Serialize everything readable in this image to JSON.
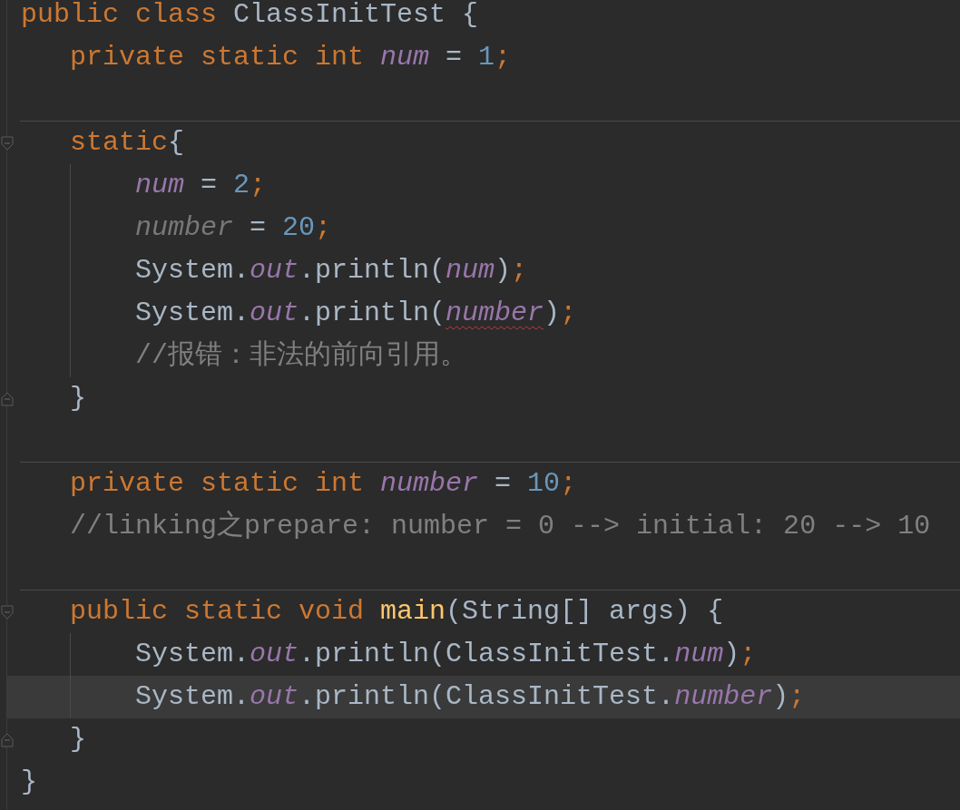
{
  "editor": {
    "lines": [
      {
        "kind": "code",
        "current": false,
        "foldable": false,
        "tokens": [
          {
            "text": "public class ",
            "kind": "keyword"
          },
          {
            "text": "ClassInitTest {",
            "kind": "plain"
          }
        ],
        "children": [
          {
            "kind": "code",
            "current": false,
            "tokens": [
              {
                "text": "private static int ",
                "kind": "keyword"
              },
              {
                "text": "num",
                "kind": "field"
              },
              {
                "text": " = ",
                "kind": "plain"
              },
              {
                "text": "1",
                "kind": "number"
              },
              {
                "text": ";",
                "kind": "keyword"
              }
            ]
          },
          {
            "kind": "separator"
          },
          {
            "kind": "code",
            "current": false,
            "foldable": true,
            "tokens": [
              {
                "text": "static",
                "kind": "keyword"
              },
              {
                "text": "{",
                "kind": "plain"
              }
            ],
            "children": [
              {
                "kind": "code",
                "current": false,
                "tokens": [
                  {
                    "text": "num",
                    "kind": "field"
                  },
                  {
                    "text": " = ",
                    "kind": "plain"
                  },
                  {
                    "text": "2",
                    "kind": "number"
                  },
                  {
                    "text": ";",
                    "kind": "keyword"
                  }
                ]
              },
              {
                "kind": "code",
                "current": false,
                "tokens": [
                  {
                    "text": "number",
                    "kind": "unused"
                  },
                  {
                    "text": " = ",
                    "kind": "plain"
                  },
                  {
                    "text": "20",
                    "kind": "number"
                  },
                  {
                    "text": ";",
                    "kind": "keyword"
                  }
                ]
              },
              {
                "kind": "code",
                "current": false,
                "tokens": [
                  {
                    "text": "System.",
                    "kind": "plain"
                  },
                  {
                    "text": "out",
                    "kind": "field"
                  },
                  {
                    "text": ".println(",
                    "kind": "plain"
                  },
                  {
                    "text": "num",
                    "kind": "field"
                  },
                  {
                    "text": ")",
                    "kind": "plain"
                  },
                  {
                    "text": ";",
                    "kind": "keyword"
                  }
                ]
              },
              {
                "kind": "code",
                "current": false,
                "tokens": [
                  {
                    "text": "System.",
                    "kind": "plain"
                  },
                  {
                    "text": "out",
                    "kind": "field"
                  },
                  {
                    "text": ".println(",
                    "kind": "plain"
                  },
                  {
                    "text": "number",
                    "kind": "error"
                  },
                  {
                    "text": ")",
                    "kind": "plain"
                  },
                  {
                    "text": ";",
                    "kind": "keyword"
                  }
                ]
              },
              {
                "kind": "code",
                "current": false,
                "tokens": [
                  {
                    "text": "//报错：非法的前向引用。",
                    "kind": "comment"
                  }
                ]
              }
            ],
            "closing": {
              "kind": "code",
              "current": false,
              "tokens": [
                {
                  "text": "}",
                  "kind": "plain"
                }
              ]
            }
          },
          {
            "kind": "separator"
          },
          {
            "kind": "code",
            "current": false,
            "tokens": [
              {
                "text": "private static int ",
                "kind": "keyword"
              },
              {
                "text": "number",
                "kind": "field"
              },
              {
                "text": " = ",
                "kind": "plain"
              },
              {
                "text": "10",
                "kind": "number"
              },
              {
                "text": ";",
                "kind": "keyword"
              }
            ]
          },
          {
            "kind": "code",
            "current": false,
            "tokens": [
              {
                "text": "//linking之prepare: number = 0 --> initial: 20 --> 10",
                "kind": "comment"
              }
            ]
          },
          {
            "kind": "separator"
          },
          {
            "kind": "code",
            "current": false,
            "foldable": true,
            "tokens": [
              {
                "text": "public static void ",
                "kind": "keyword"
              },
              {
                "text": "main",
                "kind": "declaration"
              },
              {
                "text": "(String[] args) {",
                "kind": "plain"
              }
            ],
            "children": [
              {
                "kind": "code",
                "current": false,
                "tokens": [
                  {
                    "text": "System.",
                    "kind": "plain"
                  },
                  {
                    "text": "out",
                    "kind": "field"
                  },
                  {
                    "text": ".println(ClassInitTest.",
                    "kind": "plain"
                  },
                  {
                    "text": "num",
                    "kind": "field"
                  },
                  {
                    "text": ")",
                    "kind": "plain"
                  },
                  {
                    "text": ";",
                    "kind": "keyword"
                  }
                ]
              },
              {
                "kind": "code",
                "current": true,
                "tokens": [
                  {
                    "text": "System.",
                    "kind": "plain"
                  },
                  {
                    "text": "out",
                    "kind": "field"
                  },
                  {
                    "text": ".println(ClassInitTest.",
                    "kind": "plain"
                  },
                  {
                    "text": "number",
                    "kind": "field"
                  },
                  {
                    "text": ")",
                    "kind": "plain"
                  },
                  {
                    "text": ";",
                    "kind": "keyword"
                  }
                ]
              }
            ],
            "closing": {
              "kind": "code",
              "current": false,
              "tokens": [
                {
                  "text": "}",
                  "kind": "plain"
                }
              ]
            }
          }
        ],
        "closing": {
          "kind": "code",
          "current": false,
          "tokens": [
            {
              "text": "}",
              "kind": "plain"
            }
          ]
        }
      }
    ]
  }
}
